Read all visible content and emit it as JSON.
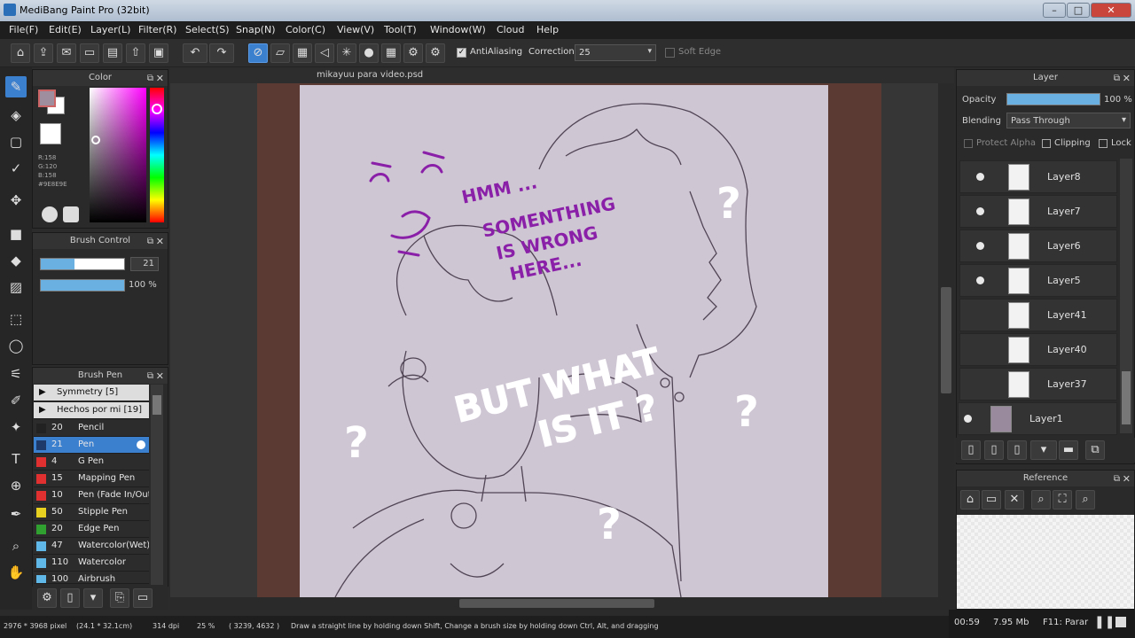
{
  "app": {
    "title": "MediBang Paint Pro (32bit)"
  },
  "menu": [
    "File(F)",
    "Edit(E)",
    "Layer(L)",
    "Filter(R)",
    "Select(S)",
    "Snap(N)",
    "Color(C)",
    "View(V)",
    "Tool(T)",
    "Window(W)",
    "Cloud",
    "Help"
  ],
  "toolbar": {
    "antialiasing": "AntiAliasing",
    "correction_label": "Correction",
    "correction_value": "25",
    "soft_edge": "Soft Edge"
  },
  "color_panel": {
    "title": "Color",
    "r": "R:158",
    "g": "G:120",
    "b": "B:158",
    "hex": "#9E8E9E"
  },
  "brush_control": {
    "title": "Brush Control",
    "size": "21",
    "opacity": "100 %"
  },
  "brush_panel": {
    "title": "Brush Pen",
    "groups": [
      "Symmetry [5]",
      "Hechos por mi [19]"
    ],
    "brushes": [
      {
        "size": "20",
        "name": "Pencil",
        "color": "#222222"
      },
      {
        "size": "21",
        "name": "Pen",
        "color": "#1e3a6a"
      },
      {
        "size": "4",
        "name": "G Pen",
        "color": "#e03030"
      },
      {
        "size": "15",
        "name": "Mapping Pen",
        "color": "#e03030"
      },
      {
        "size": "10",
        "name": "Pen (Fade In/Out)",
        "color": "#e03030"
      },
      {
        "size": "50",
        "name": "Stipple Pen",
        "color": "#e8d020"
      },
      {
        "size": "20",
        "name": "Edge Pen",
        "color": "#30a030"
      },
      {
        "size": "47",
        "name": "Watercolor(Wet)",
        "color": "#60b8e8"
      },
      {
        "size": "110",
        "name": "Watercolor",
        "color": "#60b8e8"
      },
      {
        "size": "100",
        "name": "Airbrush",
        "color": "#60b8e8"
      }
    ]
  },
  "document": {
    "tab": "mikayuu para video.psd"
  },
  "layer_panel": {
    "title": "Layer",
    "opacity_label": "Opacity",
    "opacity_value": "100 %",
    "blending_label": "Blending",
    "blending_value": "Pass Through",
    "protect_alpha": "Protect Alpha",
    "clipping": "Clipping",
    "lock": "Lock",
    "layers": [
      {
        "name": "Layer8"
      },
      {
        "name": "Layer7"
      },
      {
        "name": "Layer6"
      },
      {
        "name": "Layer5"
      },
      {
        "name": "Layer41"
      },
      {
        "name": "Layer40"
      },
      {
        "name": "Layer37"
      },
      {
        "name": "Layer1"
      }
    ]
  },
  "reference_panel": {
    "title": "Reference"
  },
  "overlay": {
    "hmm": "HMM ...",
    "line2": "SOMENTHING",
    "line3": "IS WRONG",
    "line4": "HERE...",
    "but_what": "BUT WHAT",
    "is_it": "IS IT ?",
    "q": "?"
  },
  "status": {
    "pixels": "2976 * 3968 pixel",
    "cm": "(24.1 * 32.1cm)",
    "dpi": "314 dpi",
    "zoom": "25 %",
    "coords": "( 3239, 4632 )",
    "hint": "Draw a straight line by holding down Shift, Change a brush size by holding down Ctrl, Alt, and dragging"
  },
  "taskbar": {
    "time": "00:59",
    "mem": "7.95 Mb",
    "key": "F11: Parar"
  }
}
